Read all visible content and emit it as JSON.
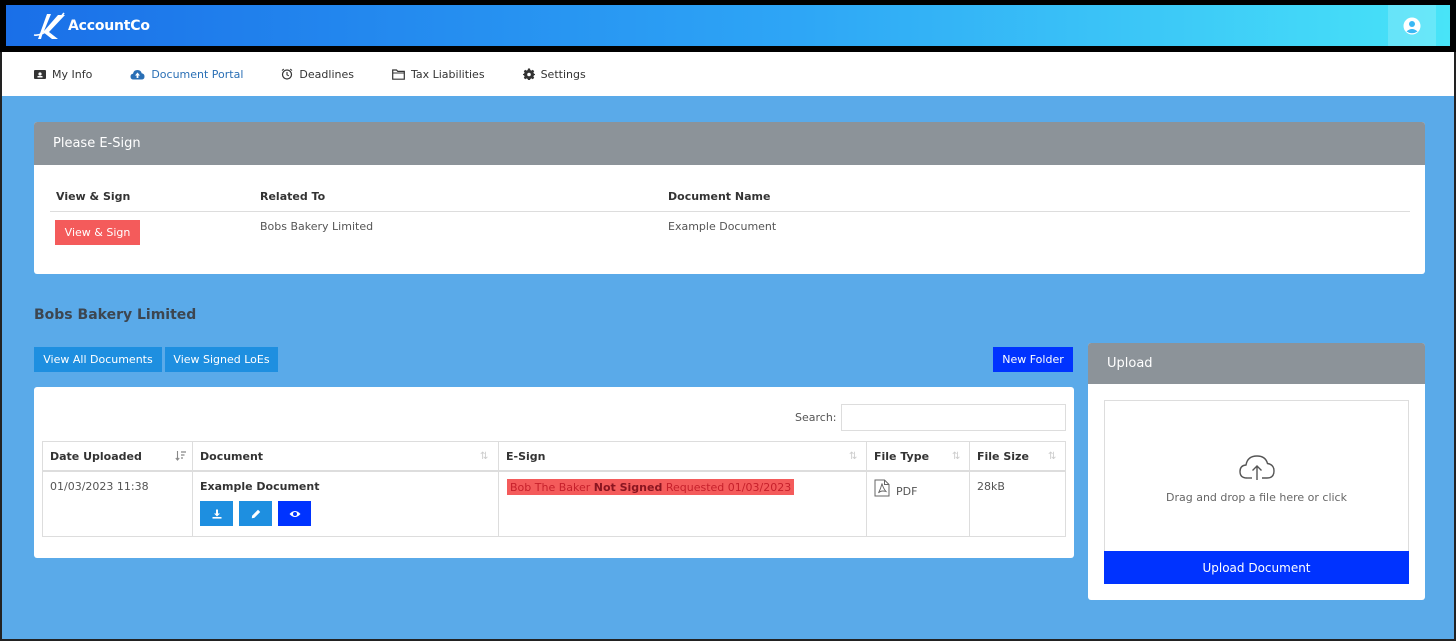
{
  "app": {
    "brand": "AccountCo"
  },
  "nav": {
    "items": [
      {
        "label": "My Info",
        "icon": "id-card-icon"
      },
      {
        "label": "Document Portal",
        "icon": "cloud-upload-icon",
        "active": true
      },
      {
        "label": "Deadlines",
        "icon": "alarm-clock-icon"
      },
      {
        "label": "Tax Liabilities",
        "icon": "folder-icon"
      },
      {
        "label": "Settings",
        "icon": "gear-icon"
      }
    ]
  },
  "esign": {
    "title": "Please E-Sign",
    "headers": [
      "View & Sign",
      "Related To",
      "Document Name"
    ],
    "row": {
      "button": "View & Sign",
      "related_to": "Bobs Bakery Limited",
      "document_name": "Example Document"
    }
  },
  "company": {
    "title": "Bobs Bakery Limited",
    "view_all_button": "View All Documents",
    "view_signed_button": "View Signed LoEs",
    "new_folder_button": "New Folder"
  },
  "documents": {
    "search_label": "Search:",
    "search_value": "",
    "columns": [
      "Date Uploaded",
      "Document",
      "E-Sign",
      "File Type",
      "File Size"
    ],
    "rows": [
      {
        "date_uploaded": "01/03/2023 11:38",
        "document": "Example Document",
        "esign_signer": "Bob The Baker",
        "esign_status": "Not Signed",
        "esign_requested": "Requested 01/03/2023",
        "file_type": "PDF",
        "file_size": "28kB"
      }
    ]
  },
  "upload": {
    "title": "Upload",
    "dropzone_text": "Drag and drop a file here or click",
    "button": "Upload Document"
  },
  "colors": {
    "page_bg": "#5aaae9",
    "panel_head": "#8c9399",
    "red_button": "#f45b5b",
    "blue_button": "#1e8fe0",
    "navy_button": "#0033ff"
  }
}
